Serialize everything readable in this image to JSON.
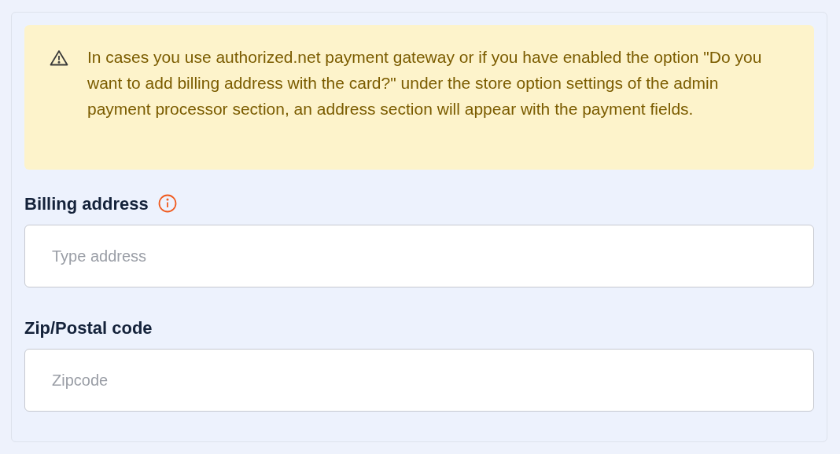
{
  "notice": {
    "text": "In cases you use authorized.net payment gateway or if you have enabled the option \"Do you want to add billing address with the card?\" under the store option settings of the admin payment processor section, an address section will appear with the payment fields."
  },
  "fields": [
    {
      "label": "Billing address",
      "info": true,
      "placeholder": "Type address"
    },
    {
      "label": "Zip/Postal code",
      "info": false,
      "placeholder": "Zipcode"
    }
  ]
}
